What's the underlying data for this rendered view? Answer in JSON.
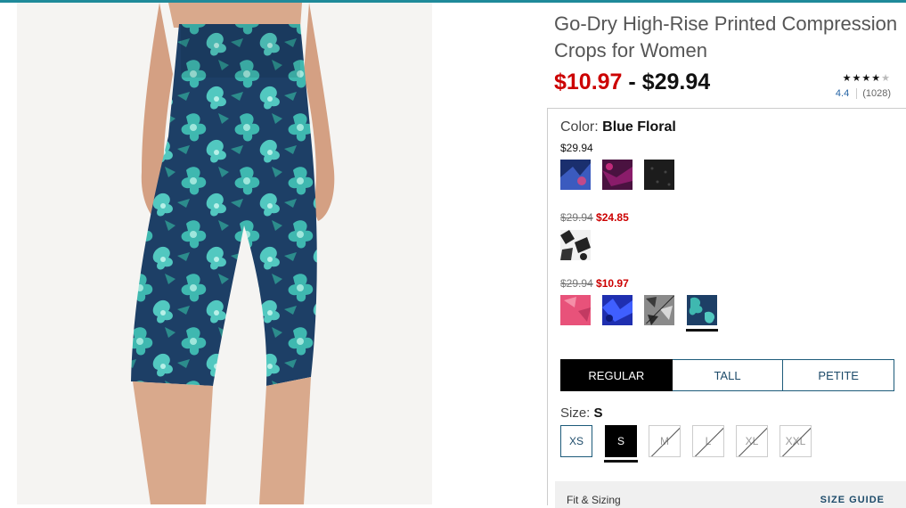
{
  "product": {
    "title": "Go-Dry High-Rise Printed Compression Crops for Women",
    "price_low": "$10.97",
    "price_separator": "-",
    "price_high": "$29.94",
    "image_alt": "Blue floral compression crops"
  },
  "rating": {
    "stars_filled": "★★★★",
    "stars_empty": "★",
    "value": 4.4,
    "score": "4.4",
    "count": "(1028)"
  },
  "color": {
    "label": "Color:",
    "selected": "Blue Floral",
    "groups": [
      {
        "price": "$29.94",
        "swatches": [
          {
            "name": "navy-print",
            "available": true
          },
          {
            "name": "plum-print",
            "available": true
          },
          {
            "name": "black-heather",
            "available": true
          }
        ]
      },
      {
        "original_price": "$29.94",
        "sale_price": "$24.85",
        "swatches": [
          {
            "name": "black-white-print",
            "available": true
          }
        ]
      },
      {
        "original_price": "$29.94",
        "sale_price": "$10.97",
        "swatches": [
          {
            "name": "pink-print",
            "available": true
          },
          {
            "name": "cobalt-print",
            "available": true
          },
          {
            "name": "grey-camo",
            "available": false
          },
          {
            "name": "blue-floral",
            "available": true,
            "selected": true
          }
        ]
      }
    ]
  },
  "fit": {
    "tabs": [
      "REGULAR",
      "TALL",
      "PETITE"
    ],
    "active": "REGULAR"
  },
  "size": {
    "label": "Size:",
    "selected": "S",
    "options": [
      {
        "label": "XS",
        "available": true
      },
      {
        "label": "S",
        "available": true,
        "selected": true
      },
      {
        "label": "M",
        "available": false
      },
      {
        "label": "L",
        "available": false
      },
      {
        "label": "XL",
        "available": false
      },
      {
        "label": "XXL",
        "available": false
      }
    ]
  },
  "fit_sizing": {
    "label": "Fit & Sizing",
    "guide_link": "SIZE GUIDE"
  },
  "colors": {
    "sale_red": "#cc0000",
    "brand_navy": "#1d4b6a",
    "accent_teal": "#1f8a9a"
  }
}
